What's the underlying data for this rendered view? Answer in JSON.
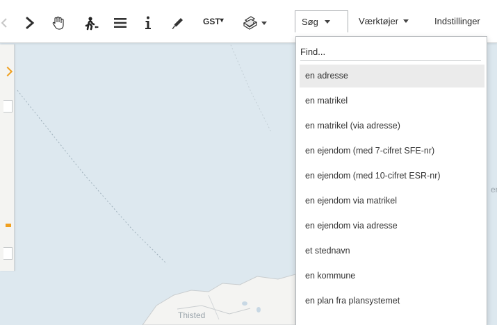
{
  "toolbar": {
    "tools": [
      {
        "icon": "arrow-right-icon"
      },
      {
        "icon": "hand-pan-icon"
      },
      {
        "icon": "walking-figure-icon"
      },
      {
        "icon": "list-icon"
      },
      {
        "icon": "info-icon"
      },
      {
        "icon": "pencil-measure-icon"
      },
      {
        "icon": "print-icon"
      }
    ],
    "gst_label": "GST",
    "search_menu": "Søg",
    "tools_menu": "Værktøjer",
    "settings_menu": "Indstillinger"
  },
  "search_dropdown": {
    "placeholder": "Find...",
    "items": [
      "en adresse",
      "en matrikel",
      "en matrikel (via adresse)",
      "en ejendom (med 7-cifret SFE-nr)",
      "en ejendom (med 10-cifret ESR-nr)",
      "en ejendom via matrikel",
      "en ejendom via adresse",
      "et stednavn",
      "en kommune",
      "en plan fra plansystemet"
    ],
    "highlighted_index": 0
  },
  "map": {
    "place_label": "Thisted",
    "edge_label": "er"
  },
  "colors": {
    "sea": "#dde8ef",
    "land": "#f4f4f2",
    "accent": "#f0a020",
    "highlight": "#ebebeb"
  }
}
